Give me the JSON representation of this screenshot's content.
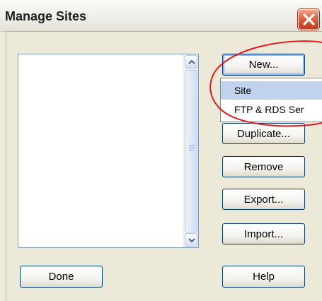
{
  "window": {
    "title": "Manage Sites"
  },
  "titlebar": {
    "close_icon": "close-icon",
    "close_color": "#d5522f"
  },
  "sites_list": {
    "items": []
  },
  "buttons": {
    "new": "New...",
    "duplicate": "Duplicate...",
    "remove": "Remove",
    "export": "Export...",
    "import": "Import...",
    "done": "Done",
    "help": "Help"
  },
  "new_menu": {
    "items": [
      "Site",
      "FTP & RDS Ser"
    ]
  },
  "annotation": {
    "shape": "ellipse",
    "color": "#e8191b"
  }
}
